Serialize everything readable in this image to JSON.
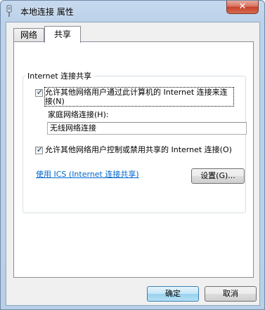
{
  "window": {
    "title": "本地连接 属性",
    "close_glyph": "✕"
  },
  "tabs": [
    {
      "label": "网络",
      "active": false
    },
    {
      "label": "共享",
      "active": true
    }
  ],
  "sharing": {
    "group_title": "Internet 连接共享",
    "allow_share": {
      "checked": true,
      "mark": "✓",
      "label": "允许其他网络用户通过此计算机的 Internet 连接来连接(N)"
    },
    "home_network_label": "家庭网络连接(H):",
    "home_network_value": "无线网络连接",
    "allow_control": {
      "checked": true,
      "mark": "✓",
      "label": "允许其他网络用户控制或禁用共享的 Internet 连接(O)"
    },
    "ics_link": "使用 ICS (Internet 连接共享)",
    "settings_button": "设置(G)..."
  },
  "footer": {
    "ok_button": "确定",
    "cancel_button": "取消"
  }
}
